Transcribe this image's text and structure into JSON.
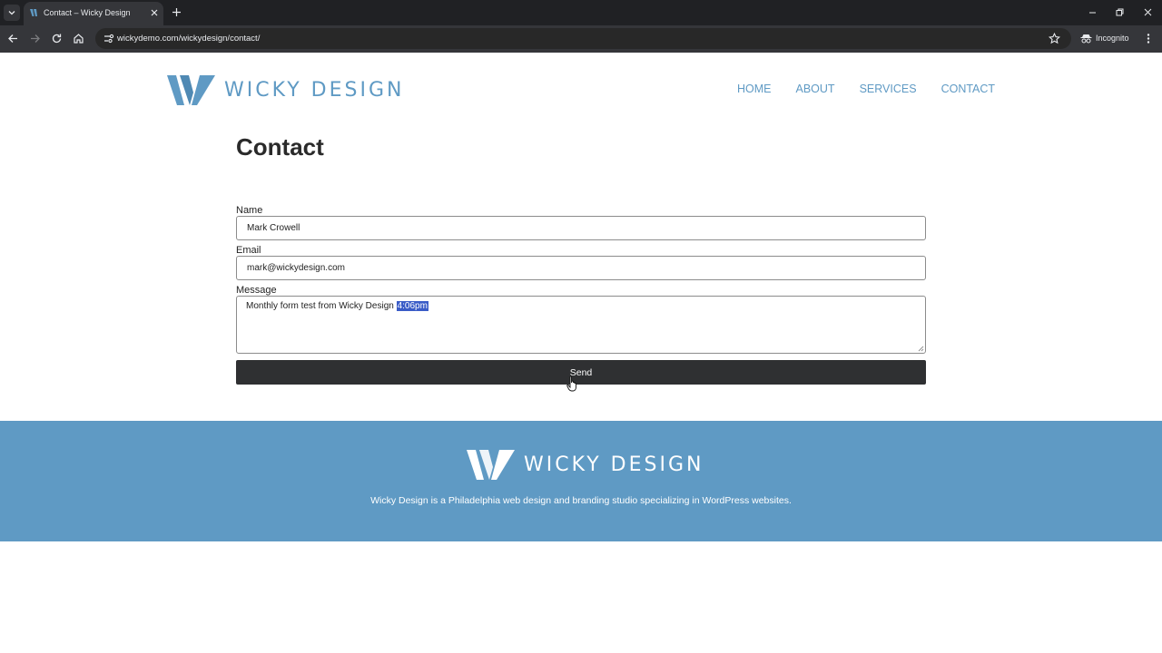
{
  "browser": {
    "tab_title": "Contact – Wicky Design",
    "url": "wickydemo.com/wickydesign/contact/",
    "incognito_label": "Incognito"
  },
  "site": {
    "logo_text": "WICKY DESIGN",
    "nav": [
      "HOME",
      "ABOUT",
      "SERVICES",
      "CONTACT"
    ],
    "accent_color": "#5f9ac4"
  },
  "form": {
    "title": "Contact",
    "name_label": "Name",
    "name_value": "Mark Crowell",
    "email_label": "Email",
    "email_value": "mark@wickydesign.com",
    "message_label": "Message",
    "message_value": "Monthly form test from Wicky Design",
    "message_selected": "4:06pm",
    "send_label": "Send"
  },
  "footer": {
    "logo_text": "WICKY DESIGN",
    "tagline": "Wicky Design is a Philadelphia web design and branding studio specializing in WordPress websites."
  }
}
